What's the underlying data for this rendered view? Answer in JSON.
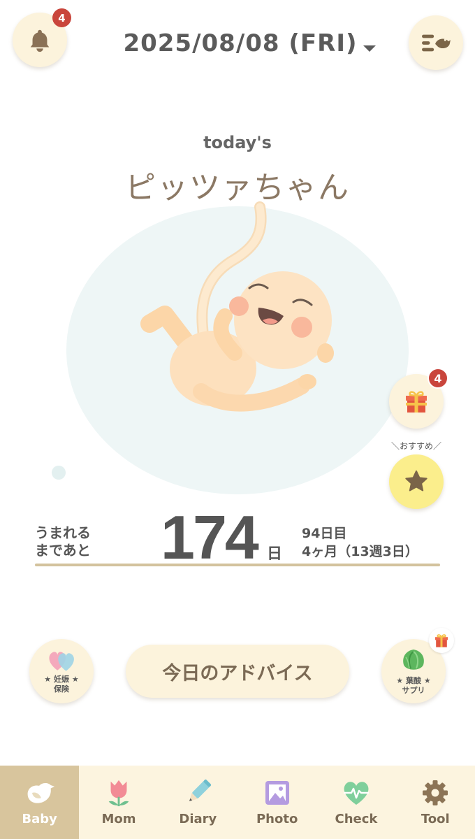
{
  "header": {
    "date": "2025/08/08 (FRI)",
    "notification_count": "4",
    "bell_icon": "bell-icon",
    "menu_icon": "menu-icon"
  },
  "baby": {
    "caption": "today's",
    "name": "ピッツァちゃん",
    "illustration": "fetus-illustration"
  },
  "side_buttons": {
    "gift_icon": "gift-icon",
    "gift_count": "4",
    "recommend_label": "＼おすすめ／",
    "recommend_icon": "star-icon"
  },
  "countdown": {
    "label_line1": "うまれる",
    "label_line2": "まであと",
    "days": "174",
    "days_unit": "日",
    "day_number": "94日目",
    "gestation": "4ヶ月（13週3日）"
  },
  "actions": {
    "insurance": {
      "icon": "hearts-icon",
      "line1": "★ 妊娠 ★",
      "line2": "保険"
    },
    "advice_label": "今日のアドバイス",
    "supplement": {
      "icon": "lettuce-icon",
      "line1": "★ 葉酸 ★",
      "line2": "サプリ",
      "badge_icon": "gift-icon"
    }
  },
  "nav": {
    "active_index": 0,
    "items": [
      {
        "label": "Baby",
        "icon": "bird-icon"
      },
      {
        "label": "Mom",
        "icon": "tulip-icon"
      },
      {
        "label": "Diary",
        "icon": "pencil-icon"
      },
      {
        "label": "Photo",
        "icon": "photo-icon"
      },
      {
        "label": "Check",
        "icon": "heart-pulse-icon"
      },
      {
        "label": "Tool",
        "icon": "gear-icon"
      }
    ]
  },
  "colors": {
    "cream": "#fcf3dc",
    "badge": "#c9453c",
    "nav_bg": "#fcf4df",
    "nav_active": "#d8c59d",
    "star_button": "#fbee8c"
  }
}
